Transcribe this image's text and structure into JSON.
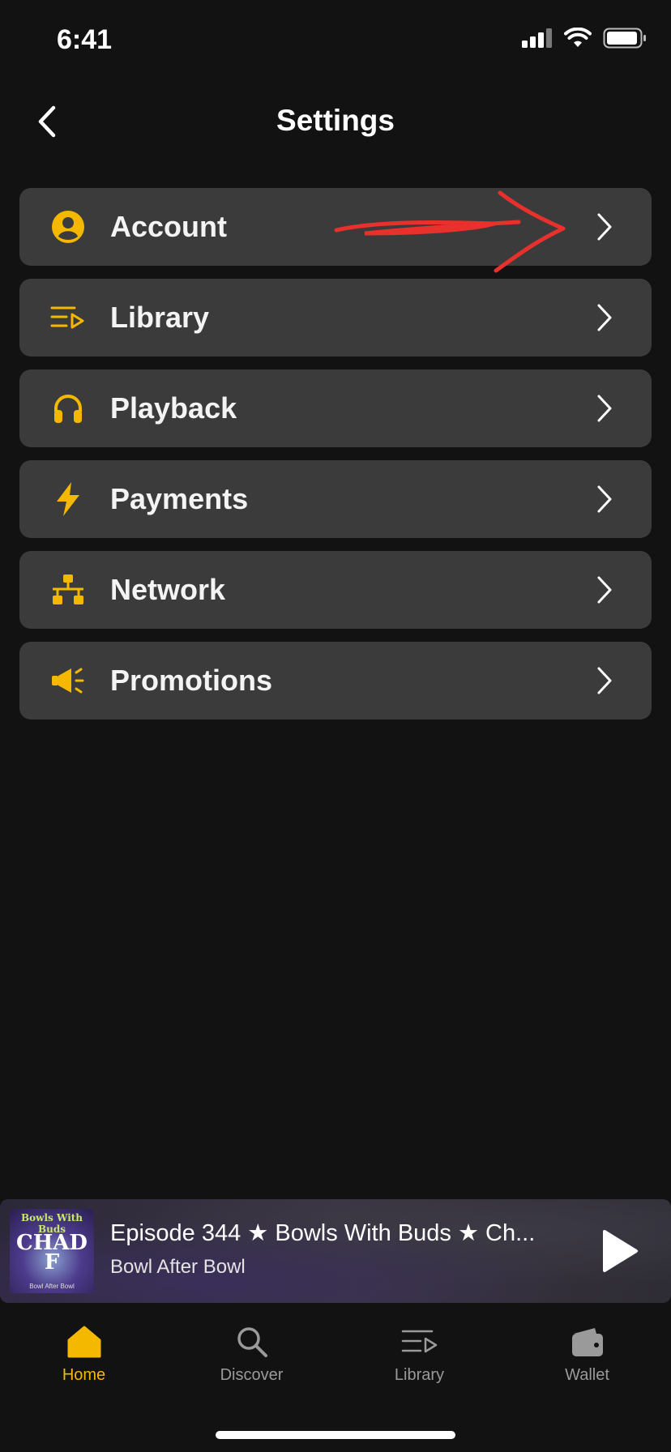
{
  "status_bar": {
    "time": "6:41"
  },
  "header": {
    "title": "Settings",
    "back_icon": "chevron-left-icon"
  },
  "settings_items": [
    {
      "label": "Account",
      "icon": "account-circle-icon"
    },
    {
      "label": "Library",
      "icon": "playlist-icon"
    },
    {
      "label": "Playback",
      "icon": "headphones-icon"
    },
    {
      "label": "Payments",
      "icon": "lightning-icon"
    },
    {
      "label": "Network",
      "icon": "network-icon"
    },
    {
      "label": "Promotions",
      "icon": "megaphone-icon"
    }
  ],
  "mini_player": {
    "title": "Episode 344 ★ Bowls With Buds ★ Ch...",
    "subtitle": "Bowl After Bowl",
    "artwork_top_text": "Bowls With Buds",
    "artwork_main_text": "CHAD F",
    "artwork_bottom_text": "Bowl After Bowl"
  },
  "tab_bar": {
    "items": [
      {
        "label": "Home",
        "icon": "home-icon",
        "active": true
      },
      {
        "label": "Discover",
        "icon": "search-icon",
        "active": false
      },
      {
        "label": "Library",
        "icon": "library-icon",
        "active": false
      },
      {
        "label": "Wallet",
        "icon": "wallet-icon",
        "active": false
      }
    ]
  },
  "colors": {
    "accent": "#F5B800",
    "annotation": "#E8302C",
    "row_background": "#3B3B3B",
    "page_background": "#121212"
  }
}
